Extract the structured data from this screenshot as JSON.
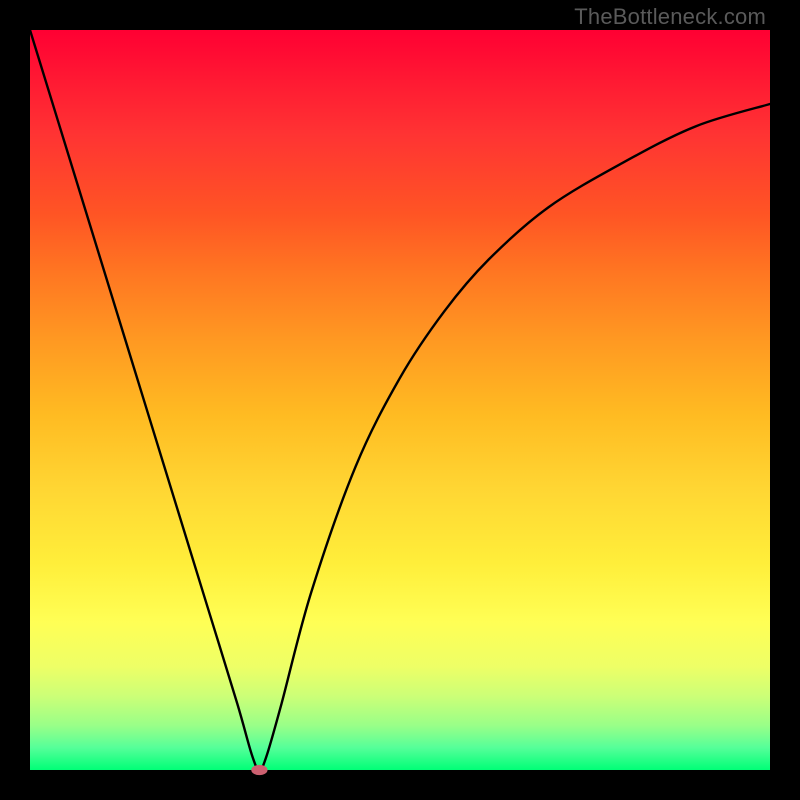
{
  "watermark": "TheBottleneck.com",
  "chart_data": {
    "type": "line",
    "title": "",
    "xlabel": "",
    "ylabel": "",
    "xlim": [
      0,
      100
    ],
    "ylim": [
      0,
      100
    ],
    "grid": false,
    "legend": false,
    "series": [
      {
        "name": "curve",
        "x": [
          0,
          4,
          8,
          12,
          16,
          20,
          24,
          28,
          30,
          31,
          32,
          34,
          38,
          44,
          50,
          56,
          62,
          70,
          80,
          90,
          100
        ],
        "y": [
          100,
          87,
          74,
          61,
          48,
          35,
          22,
          9,
          2,
          0,
          2,
          9,
          24,
          41,
          53,
          62,
          69,
          76,
          82,
          87,
          90
        ]
      }
    ],
    "marker": {
      "x": 31,
      "y": 0,
      "rx": 1.1,
      "ry": 0.7,
      "color": "#cc6070"
    }
  }
}
